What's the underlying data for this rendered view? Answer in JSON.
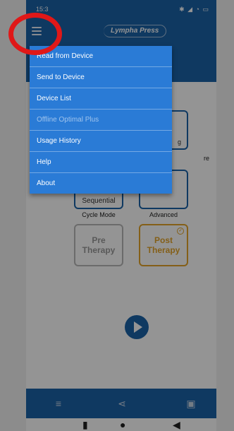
{
  "status_bar": {
    "time": "15:3",
    "alarm_icon": "alarm-icon",
    "right_icons": "✱ ◢ ◔ ▭"
  },
  "app_bar": {
    "logo_text": "Lympha Press",
    "menu_icon": "hamburger-menu-icon"
  },
  "tiles": {
    "top_right_partial_text": "g",
    "top_right_partial_label": "re",
    "sequential_partial": "Sequential",
    "cycle_mode_label": "Cycle Mode",
    "advanced_label": "Advanced",
    "pre_therapy": "Pre Therapy",
    "post_therapy": "Post Therapy"
  },
  "menu": {
    "items": [
      {
        "label": "Read from Device",
        "enabled": true
      },
      {
        "label": "Send to Device",
        "enabled": true
      },
      {
        "label": "Device List",
        "enabled": true
      },
      {
        "label": "Offline Optimal Plus",
        "enabled": false
      },
      {
        "label": "Usage History",
        "enabled": true
      },
      {
        "label": "Help",
        "enabled": true
      },
      {
        "label": "About",
        "enabled": true
      }
    ]
  },
  "colors": {
    "primary": "#1b62a8",
    "menu_bg": "#2a7bd6",
    "post_accent": "#e3a42a",
    "highlight": "#e01818"
  },
  "bottom_bar": {
    "icons": [
      "sort-icon",
      "share-icon",
      "save-icon"
    ]
  },
  "nav_bar": {
    "icons": [
      "recents-icon",
      "home-icon",
      "back-icon"
    ]
  }
}
